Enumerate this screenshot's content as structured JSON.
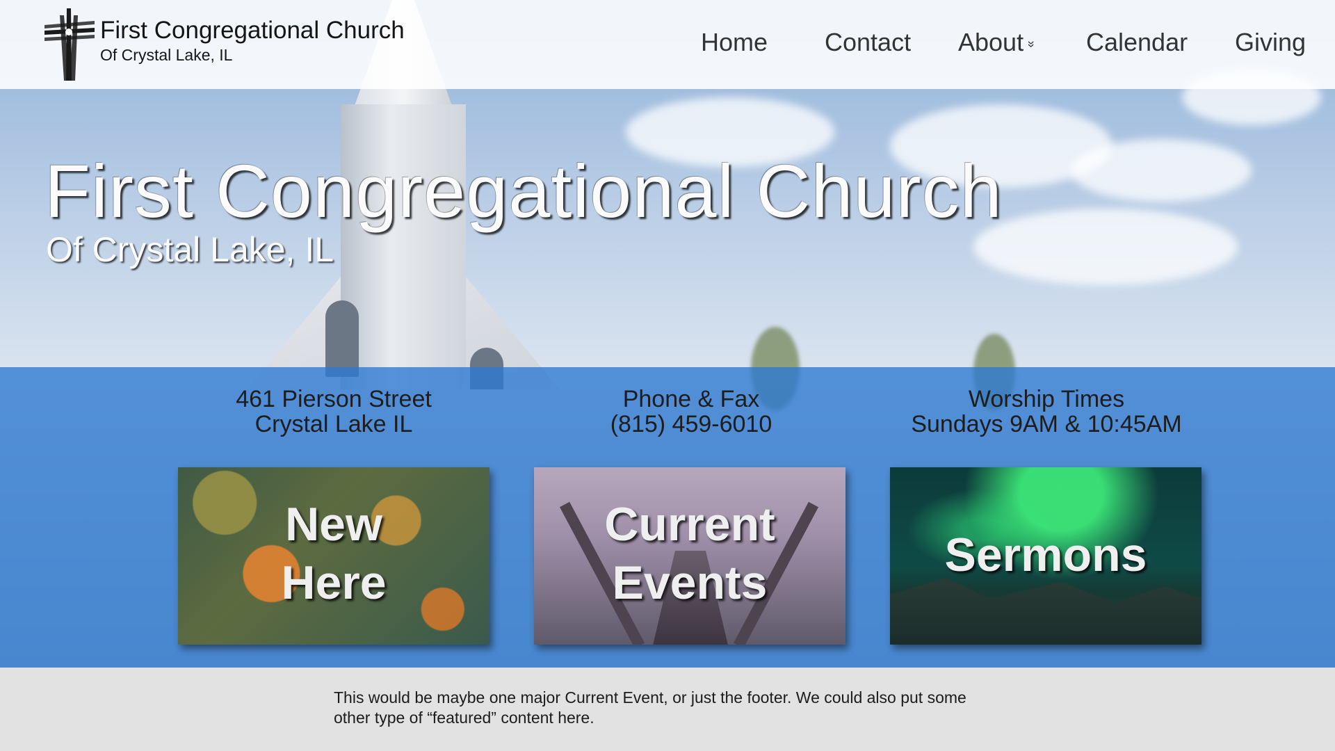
{
  "brand": {
    "title": "First Congregational Church",
    "subtitle": "Of Crystal Lake, IL",
    "logo_icon": "cross-logo-icon"
  },
  "nav": {
    "items": [
      {
        "label": "Home"
      },
      {
        "label": "Contact"
      },
      {
        "label": "About",
        "icon": "chevron-down-icon",
        "chevron": "»"
      },
      {
        "label": "Calendar"
      },
      {
        "label": "Giving"
      }
    ]
  },
  "hero": {
    "title": "First Congregational Church",
    "subtitle": "Of Crystal Lake, IL"
  },
  "info": {
    "address": {
      "line1": "461 Pierson Street",
      "line2": "Crystal Lake IL"
    },
    "phone": {
      "line1": "Phone & Fax",
      "line2": "(815) 459-6010"
    },
    "worship": {
      "line1": "Worship Times",
      "line2": "Sundays 9AM & 10:45AM"
    }
  },
  "cards": [
    {
      "line1": "New",
      "line2": "Here"
    },
    {
      "line1": "Current",
      "line2": "Events"
    },
    {
      "line1": "Sermons"
    }
  ],
  "footer": {
    "text": "This would be maybe one major Current Event, or just the footer. We could also put some other type of “featured” content here."
  },
  "colors": {
    "band": "#2c78d2",
    "footer_bg": "#e2e2e2",
    "nav_text": "#333333"
  }
}
